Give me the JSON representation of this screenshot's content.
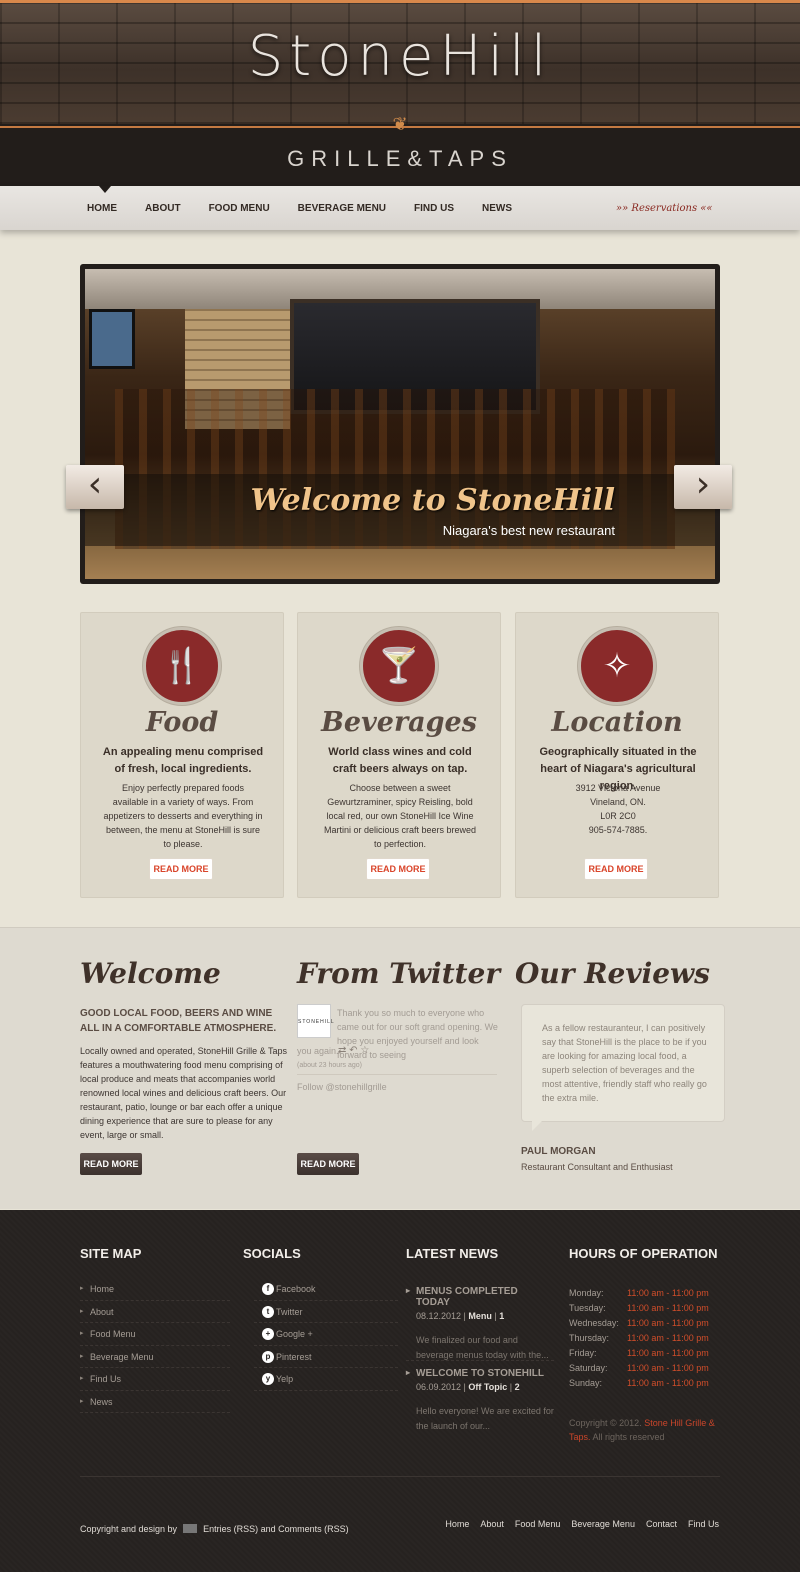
{
  "header": {
    "logo": "StoneHill",
    "subtitle": "GRILLE&TAPS",
    "flourish": "❦"
  },
  "nav": {
    "items": [
      "HOME",
      "ABOUT",
      "FOOD MENU",
      "BEVERAGE MENU",
      "FIND US",
      "NEWS"
    ],
    "active": "HOME",
    "reservations": "»» Reservations ««"
  },
  "slider": {
    "title": "Welcome to StoneHill",
    "subtitle": "Niagara's best new restaurant",
    "prev_icon": "chevron-left-icon",
    "next_icon": "chevron-right-icon"
  },
  "features": [
    {
      "icon": "cutlery-icon",
      "title": "Food",
      "lead": "An appealing menu comprised of fresh, local ingredients.",
      "body": "Enjoy perfectly prepared foods available in a variety of ways. From appetizers to desserts and everything in between, the menu at StoneHill is sure to please.",
      "button": "READ MORE"
    },
    {
      "icon": "martini-icon",
      "title": "Beverages",
      "lead": "World class wines and cold craft beers always on tap.",
      "body": "Choose between a sweet Gewurtzraminer, spicy Reisling, bold local red, our own StoneHill Ice Wine Martini or delicious craft beers brewed to perfection.",
      "button": "READ MORE"
    },
    {
      "icon": "compass-icon",
      "title": "Location",
      "lead": "Geographically situated in the heart of Niagara's agricultural region.",
      "body": "3912 Victoria Avenue\nVineland, ON.\nL0R 2C0\n905-574-7885.",
      "button": "READ MORE"
    }
  ],
  "welcome": {
    "title": "Welcome",
    "lead": "GOOD LOCAL FOOD, BEERS AND WINE ALL IN A COMFORTABLE ATMOSPHERE.",
    "body": "Locally owned and operated, StoneHill Grille & Taps features a mouthwatering food menu comprising of local produce and meats that accompanies world renowned local wines and delicious craft beers. Our restaurant, patio, lounge or bar each offer a unique dining experience that are sure to please for any event, large or small.",
    "button": "READ MORE"
  },
  "twitter": {
    "title": "From Twitter",
    "avatar_text": "STONEHILL",
    "tweet": "Thank you so much to everyone who came out for our soft grand opening. We hope you enjoyed yourself and look forward to seeing",
    "tweet_end": "you again.",
    "actions": "⇄ ↶ ☆",
    "time": "(about 23 hours ago)",
    "follow": "Follow @stonehillgrille",
    "button": "READ MORE"
  },
  "reviews": {
    "title": "Our Reviews",
    "text": "As a fellow restauranteur, I can positively say that StoneHill is the place to be if you are looking for amazing local food, a superb selection of beverages and the most attentive, friendly staff who really go the extra mile.",
    "name": "PAUL MORGAN",
    "role": "Restaurant Consultant and Enthusiast"
  },
  "footer": {
    "sitemap_title": "SITE MAP",
    "sitemap": [
      "Home",
      "About",
      "Food Menu",
      "Beverage Menu",
      "Find Us",
      "News"
    ],
    "socials_title": "SOCIALS",
    "socials": [
      {
        "label": "Facebook",
        "glyph": "f",
        "icon": "facebook-icon"
      },
      {
        "label": "Twitter",
        "glyph": "t",
        "icon": "twitter-icon"
      },
      {
        "label": "Google +",
        "glyph": "+",
        "icon": "google-plus-icon"
      },
      {
        "label": "Pinterest",
        "glyph": "p",
        "icon": "pinterest-icon"
      },
      {
        "label": "Yelp",
        "glyph": "y",
        "icon": "yelp-icon"
      }
    ],
    "news_title": "LATEST NEWS",
    "news": [
      {
        "title": "MENUS COMPLETED TODAY",
        "date": "08.12.2012",
        "category": "Menu",
        "comments": "1",
        "excerpt": "We finalized our food and beverage menus today with the..."
      },
      {
        "title": "WELCOME TO STONEHILL",
        "date": "06.09.2012",
        "category": "Off Topic",
        "comments": "2",
        "excerpt": "Hello everyone! We are excited for the launch of our..."
      }
    ],
    "hours_title": "HOURS OF OPERATION",
    "hours": [
      {
        "day": "Monday:",
        "time": "11:00 am - 11:00 pm"
      },
      {
        "day": "Tuesday:",
        "time": "11:00 am - 11:00 pm"
      },
      {
        "day": "Wednesday:",
        "time": "11:00 am - 11:00 pm"
      },
      {
        "day": "Thursday:",
        "time": "11:00 am - 11:00 pm"
      },
      {
        "day": "Friday:",
        "time": "11:00 am - 11:00 pm"
      },
      {
        "day": "Saturday:",
        "time": "11:00 am - 11:00 pm"
      },
      {
        "day": "Sunday:",
        "time": "11:00 am - 11:00 pm"
      }
    ],
    "copyright_pre": "Copyright © 2012.",
    "copyright_name": "Stone Hill Grille & Taps.",
    "copyright_post": "All rights reserved",
    "bottom_left_pre": "Copyright and design by",
    "bottom_left_post": "Entries (RSS) and Comments (RSS)",
    "bottom_links": [
      "Home",
      "About",
      "Food Menu",
      "Beverage Menu",
      "Contact",
      "Find Us"
    ]
  },
  "colors": {
    "accent": "#8a2a2a",
    "link_red": "#d04d2a",
    "footer_bg": "#262220",
    "page_bg": "#e8e4d7"
  }
}
